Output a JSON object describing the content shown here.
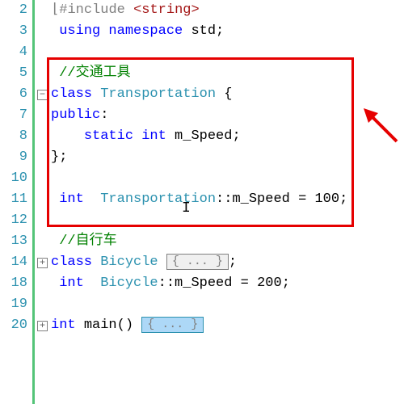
{
  "lines": {
    "n2": "2",
    "n3": "3",
    "n4": "4",
    "n5": "5",
    "n6": "6",
    "n7": "7",
    "n8": "8",
    "n9": "9",
    "n10": "10",
    "n11": "11",
    "n12": "12",
    "n13": "13",
    "n14": "14",
    "n18": "18",
    "n19": "19",
    "n20": "20"
  },
  "fold": {
    "minus": "−",
    "plus": "+"
  },
  "code": {
    "l2": {
      "pp": "#include ",
      "lt": "<",
      "hdr": "string",
      "gt": ">"
    },
    "l3": {
      "using": "using",
      "ns": " namespace ",
      "std": "std",
      "semi": ";"
    },
    "l5": {
      "cmt": "//交通工具"
    },
    "l6": {
      "class": "class",
      "sp": " ",
      "name": "Transportation",
      "brace": " {"
    },
    "l7": {
      "public": "public",
      "colon": ":"
    },
    "l8": {
      "indent": "    ",
      "static": "static",
      "sp1": " ",
      "int": "int",
      "sp2": " ",
      "var": "m_Speed",
      "semi": ";"
    },
    "l9": {
      "brace": "}",
      "semi": ";"
    },
    "l11": {
      "int": "int",
      "sp1": "  ",
      "name": "Transportation",
      "scope": "::",
      "var": "m_Speed",
      "eq": " = ",
      "val": "100",
      "semi": ";"
    },
    "l13": {
      "cmt": "//自行车"
    },
    "l14": {
      "class": "class",
      "sp": " ",
      "name": "Bicycle",
      "collapsed": "{ ... }",
      "semi": ";"
    },
    "l18": {
      "int": "int",
      "sp1": "  ",
      "name": "Bicycle",
      "scope": "::",
      "var": "m_Speed",
      "eq": " = ",
      "val": "200",
      "semi": ";"
    },
    "l20": {
      "int": "int",
      "sp": " ",
      "main": "main",
      "paren": "()",
      "collapsed": "{ ... }"
    }
  }
}
